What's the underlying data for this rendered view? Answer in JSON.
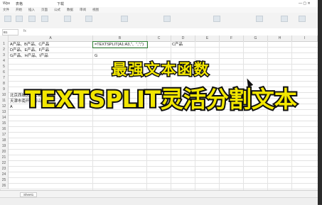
{
  "titlebar": {
    "app_title": "Wps",
    "tab_name": "表格",
    "extra": "下载"
  },
  "menubar": [
    "文件",
    "开始",
    "插入",
    "页面",
    "公式",
    "数据",
    "审阅",
    "视图"
  ],
  "namebox": "B1",
  "formula_bar": {
    "fx": "fx",
    "content": ""
  },
  "columns": [
    "A",
    "B",
    "C",
    "D",
    "E",
    "F",
    "G",
    "H",
    "I"
  ],
  "rows": [
    "1",
    "2",
    "3",
    "4",
    "5",
    "6",
    "7",
    "8",
    "9",
    "10",
    "11",
    "12",
    "13",
    "14",
    "15",
    "16",
    "17",
    "18",
    "19",
    "20",
    "21",
    "22",
    "23",
    "24",
    "25",
    "26"
  ],
  "cells": {
    "a1": "A产品、B产品、C产品",
    "a2": "D产品、E产品、F产品",
    "a3": "G产品、H产品、I产品",
    "b1": "=TEXTSPLIT(A1:A3,\"、\",\";\")",
    "d1": "C产品",
    "b3": "G",
    "a7": "北京西城区西大街新街口",
    "a8": "天津市南开区鞍山西路",
    "a9": "A"
  },
  "overlay": {
    "line1": "最强文本函数",
    "line2": "TEXTSPLIT灵活分割文本"
  },
  "sheet_tab": "Sheet1",
  "colors": {
    "accent": "#2e7d32",
    "overlay_fill": "#f2e600",
    "overlay_stroke": "#111111"
  }
}
